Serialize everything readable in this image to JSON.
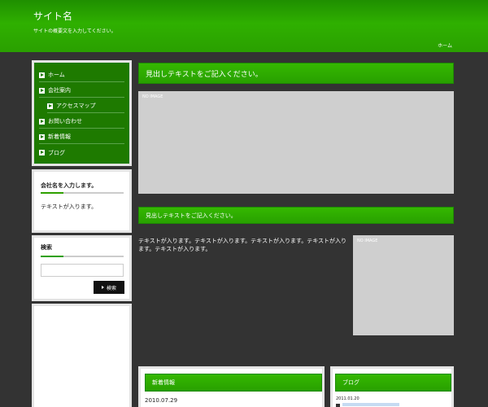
{
  "header": {
    "site_title": "サイト名",
    "site_desc": "サイトの概要文を入力してください。",
    "home_link": "ホーム"
  },
  "nav": {
    "items": [
      {
        "label": "ホーム"
      },
      {
        "label": "会社案内"
      },
      {
        "label": "アクセスマップ"
      },
      {
        "label": "お問い合わせ"
      },
      {
        "label": "新着情報"
      },
      {
        "label": "ブログ"
      }
    ]
  },
  "company_box": {
    "title": "会社名を入力します。",
    "text": "テキストが入ります。"
  },
  "search_box": {
    "title": "検索",
    "input_value": "",
    "button_label": "検索"
  },
  "main": {
    "heading1": "見出しテキストをご記入ください。",
    "image1_label": "NO IMAGE",
    "heading2": "見出しテキストをご記入ください。",
    "body_text": "テキストが入ります。テキストが入ります。テキストが入ります。テキストが入ります。テキストが入ります。",
    "image2_label": "NO IMAGE"
  },
  "news": {
    "title": "新着情報",
    "date": "2010.07.29"
  },
  "blog": {
    "title": "ブログ",
    "date": "2011.01.20"
  },
  "colors": {
    "accent_green": "#2fb000",
    "background": "#333333",
    "placeholder_gray": "#cfcfcf",
    "link_blue": "#3a8bd8"
  }
}
